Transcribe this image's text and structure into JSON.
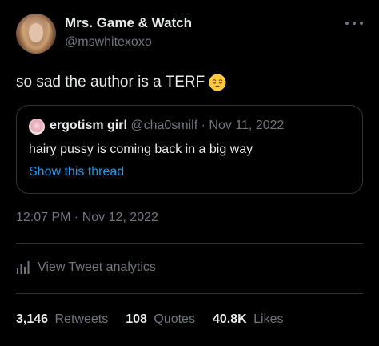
{
  "author": {
    "display_name": "Mrs. Game & Watch",
    "handle": "@mswhitexoxo"
  },
  "more_icon": "more-horizontal-icon",
  "tweet": {
    "text": "so sad the author is a TERF",
    "emoji": "pensive-face-emoji"
  },
  "quote": {
    "name": "ergotism girl",
    "handle": "@cha0smilf",
    "separator": "·",
    "date": "Nov 11, 2022",
    "text": "hairy pussy is coming back in a big way",
    "show_thread": "Show this thread"
  },
  "timestamp": "12:07 PM · Nov 12, 2022",
  "analytics": {
    "label": "View Tweet analytics",
    "icon": "bar-chart-icon"
  },
  "stats": {
    "retweets": {
      "count": "3,146",
      "label": "Retweets"
    },
    "quotes": {
      "count": "108",
      "label": "Quotes"
    },
    "likes": {
      "count": "40.8K",
      "label": "Likes"
    }
  },
  "colors": {
    "background": "#000000",
    "text_primary": "#e7e9ea",
    "text_secondary": "#71767b",
    "link": "#1d9bf0",
    "border": "#2f3336"
  }
}
